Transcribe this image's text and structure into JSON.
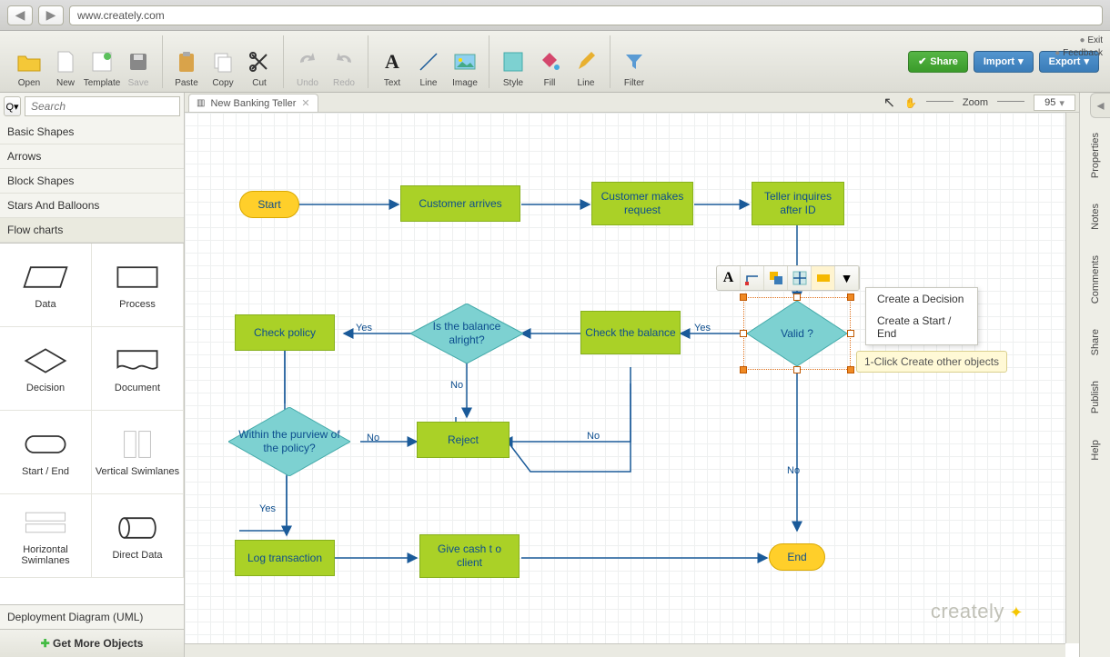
{
  "url": "www.creately.com",
  "toolbar": {
    "open": "Open",
    "new": "New",
    "template": "Template",
    "save": "Save",
    "paste": "Paste",
    "copy": "Copy",
    "cut": "Cut",
    "undo": "Undo",
    "redo": "Redo",
    "text": "Text",
    "line": "Line",
    "image": "Image",
    "style": "Style",
    "fill": "Fill",
    "line2": "Line",
    "filter": "Filter",
    "share": "Share",
    "import": "Import",
    "export": "Export"
  },
  "meta": {
    "exit": "Exit",
    "feedback": "Feedback"
  },
  "search": {
    "placeholder": "Search"
  },
  "categories": [
    "Basic Shapes",
    "Arrows",
    "Block Shapes",
    "Stars And Balloons",
    "Flow charts"
  ],
  "shapes": [
    "Data",
    "Process",
    "Decision",
    "Document",
    "Start / End",
    "Vertical Swimlanes",
    "Horizontal Swimlanes",
    "Direct Data"
  ],
  "panel_footer": "Deployment Diagram (UML)",
  "get_more": "Get More Objects",
  "tab": {
    "title": "New Banking Teller"
  },
  "zoom": {
    "label": "Zoom",
    "value": "95"
  },
  "right_rail": [
    "Properties",
    "Notes",
    "Comments",
    "Share",
    "Publish",
    "Help"
  ],
  "context_menu": [
    "Create a Decision",
    "Create a Start / End"
  ],
  "tooltip": "1-Click Create other objects",
  "logo": "creately",
  "flow": {
    "start": "Start",
    "customer_arrives": "Customer arrives",
    "customer_request": "Customer makes request",
    "teller_inquires": "Teller inquires after ID",
    "valid": "Valid ?",
    "check_balance": "Check the balance",
    "balance_ok": "Is the balance  alright?",
    "check_policy": "Check policy",
    "within_policy": "Within the purview  of the policy?",
    "reject": "Reject",
    "log_txn": "Log transaction",
    "give_cash": "Give cash t o client",
    "end": "End",
    "yes": "Yes",
    "no": "No"
  }
}
